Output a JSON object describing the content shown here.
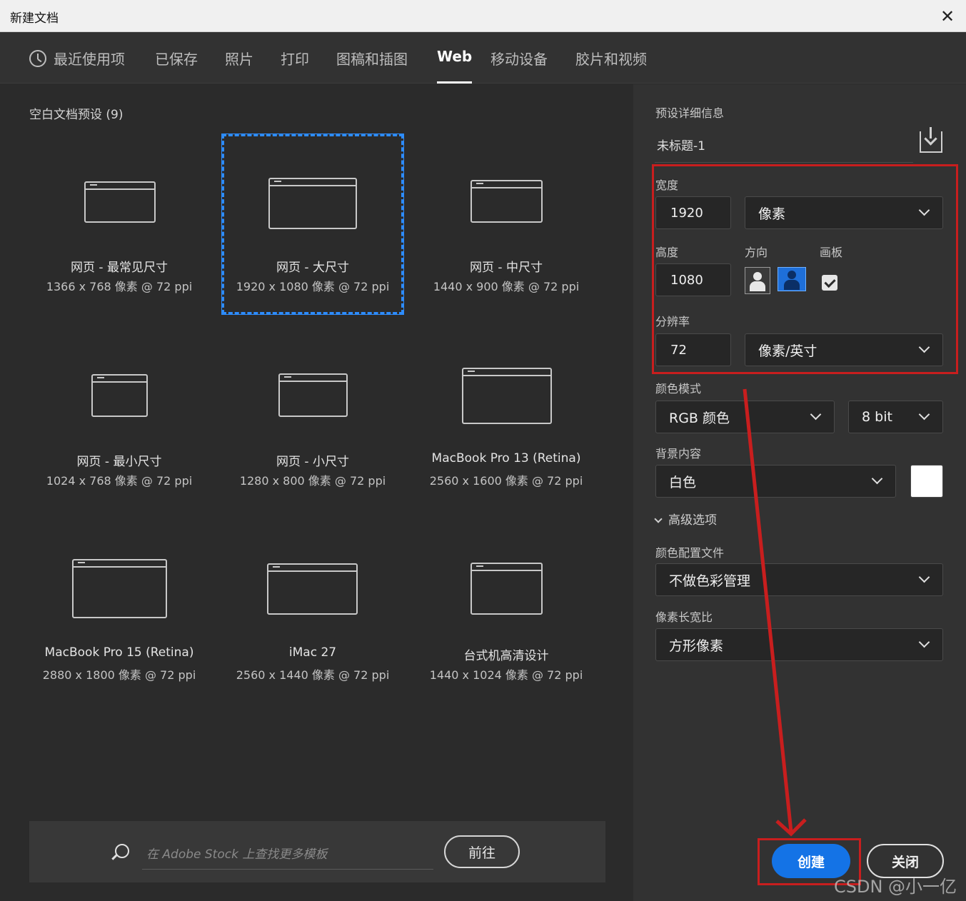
{
  "window": {
    "title": "新建文档",
    "close_glyph": "✕"
  },
  "tabs": [
    {
      "label": "最近使用项",
      "icon": "clock-icon"
    },
    {
      "label": "已保存"
    },
    {
      "label": "照片"
    },
    {
      "label": "打印"
    },
    {
      "label": "图稿和插图"
    },
    {
      "label": "Web",
      "active": true
    },
    {
      "label": "移动设备"
    },
    {
      "label": "胶片和视频"
    }
  ],
  "presets": {
    "title": "空白文档预设 (9)",
    "items": [
      {
        "name": "网页 - 最常见尺寸",
        "size": "1366 x 768 像素 @ 72 ppi"
      },
      {
        "name": "网页 - 大尺寸",
        "size": "1920 x 1080 像素 @ 72 ppi",
        "selected": true
      },
      {
        "name": "网页 - 中尺寸",
        "size": "1440 x 900 像素 @ 72 ppi"
      },
      {
        "name": "网页 - 最小尺寸",
        "size": "1024 x 768 像素 @ 72 ppi"
      },
      {
        "name": "网页 - 小尺寸",
        "size": "1280 x 800 像素 @ 72 ppi"
      },
      {
        "name": "MacBook Pro 13 (Retina)",
        "size": "2560 x 1600 像素 @ 72 ppi"
      },
      {
        "name": "MacBook Pro 15 (Retina)",
        "size": "2880 x 1800 像素 @ 72 ppi"
      },
      {
        "name": "iMac 27",
        "size": "2560 x 1440 像素 @ 72 ppi"
      },
      {
        "name": "台式机高清设计",
        "size": "1440 x 1024 像素 @ 72 ppi"
      }
    ]
  },
  "stock": {
    "placeholder": "在 Adobe Stock 上查找更多模板",
    "go_label": "前往"
  },
  "details": {
    "title": "预设详细信息",
    "doc_name": "未标题-1",
    "width_label": "宽度",
    "width_value": "1920",
    "width_unit": "像素",
    "height_label": "高度",
    "height_value": "1080",
    "orientation_label": "方向",
    "artboard_label": "画板",
    "artboard_checked": true,
    "resolution_label": "分辨率",
    "resolution_value": "72",
    "resolution_unit": "像素/英寸",
    "color_mode_label": "颜色模式",
    "color_mode_value": "RGB 颜色",
    "bit_depth_value": "8 bit",
    "background_label": "背景内容",
    "background_value": "白色",
    "background_color": "#ffffff",
    "advanced_label": "高级选项",
    "color_profile_label": "颜色配置文件",
    "color_profile_value": "不做色彩管理",
    "pixel_aspect_label": "像素长宽比",
    "pixel_aspect_value": "方形像素"
  },
  "buttons": {
    "create": "创建",
    "close": "关闭"
  },
  "watermark": "CSDN @小一亿",
  "colors": {
    "accent": "#1473e6",
    "annotation": "#c81e1e",
    "selection": "#2d8cff"
  }
}
